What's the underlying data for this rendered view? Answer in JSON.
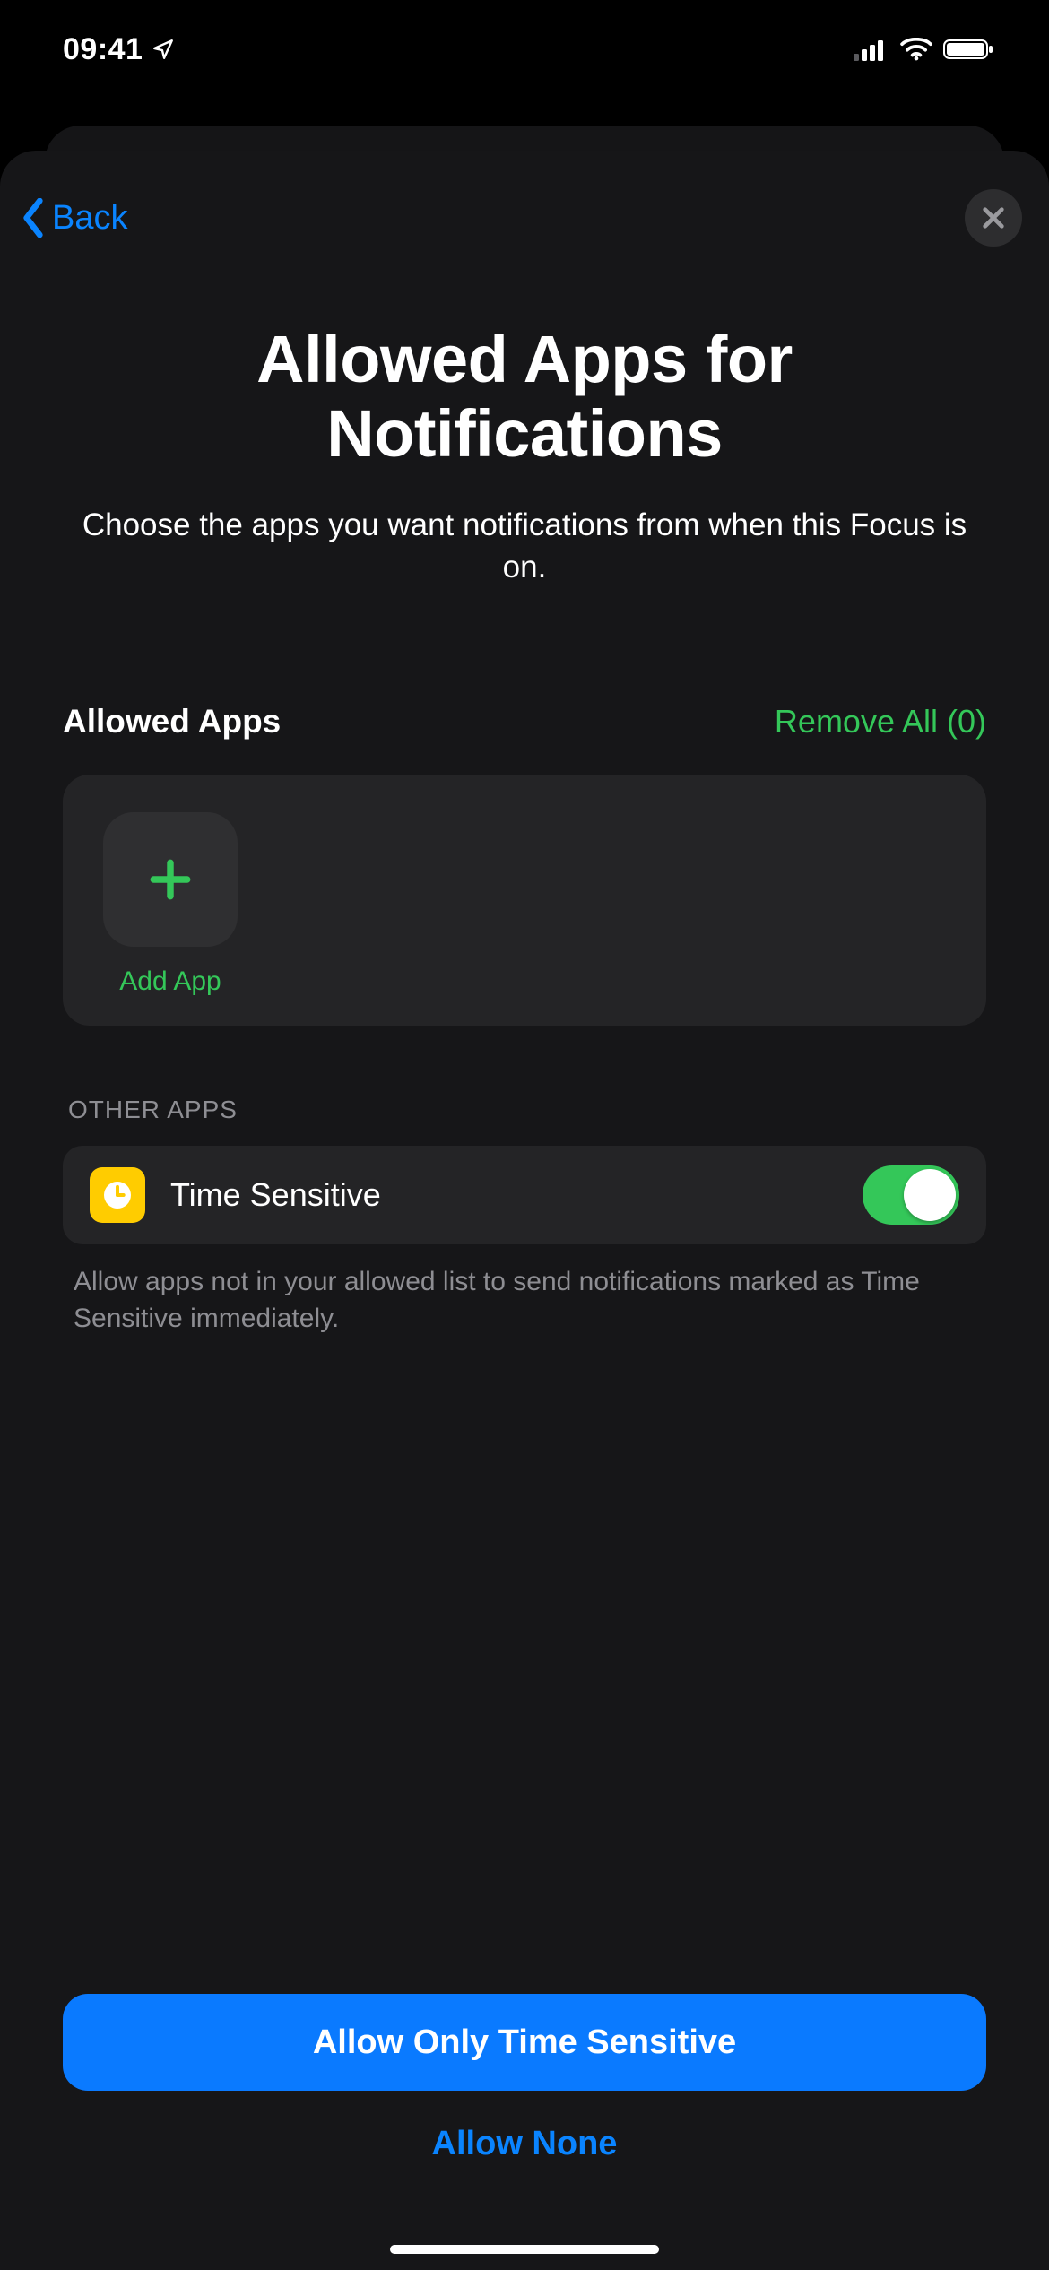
{
  "status": {
    "time": "09:41"
  },
  "nav": {
    "back_label": "Back"
  },
  "header": {
    "title": "Allowed Apps for Notifications",
    "subtitle": "Choose the apps you want notifications from when this Focus is on."
  },
  "allowed": {
    "title": "Allowed Apps",
    "remove_all_label": "Remove All (0)",
    "add_app_label": "Add App"
  },
  "other": {
    "header": "OTHER APPS",
    "time_sensitive": {
      "label": "Time Sensitive",
      "enabled": true
    },
    "footer": "Allow apps not in your allowed list to send notifications marked as Time Sensitive immediately."
  },
  "actions": {
    "primary": "Allow Only Time Sensitive",
    "secondary": "Allow None"
  },
  "colors": {
    "accent_blue": "#0a84ff",
    "accent_green": "#34c759",
    "icon_yellow": "#ffcc00"
  }
}
